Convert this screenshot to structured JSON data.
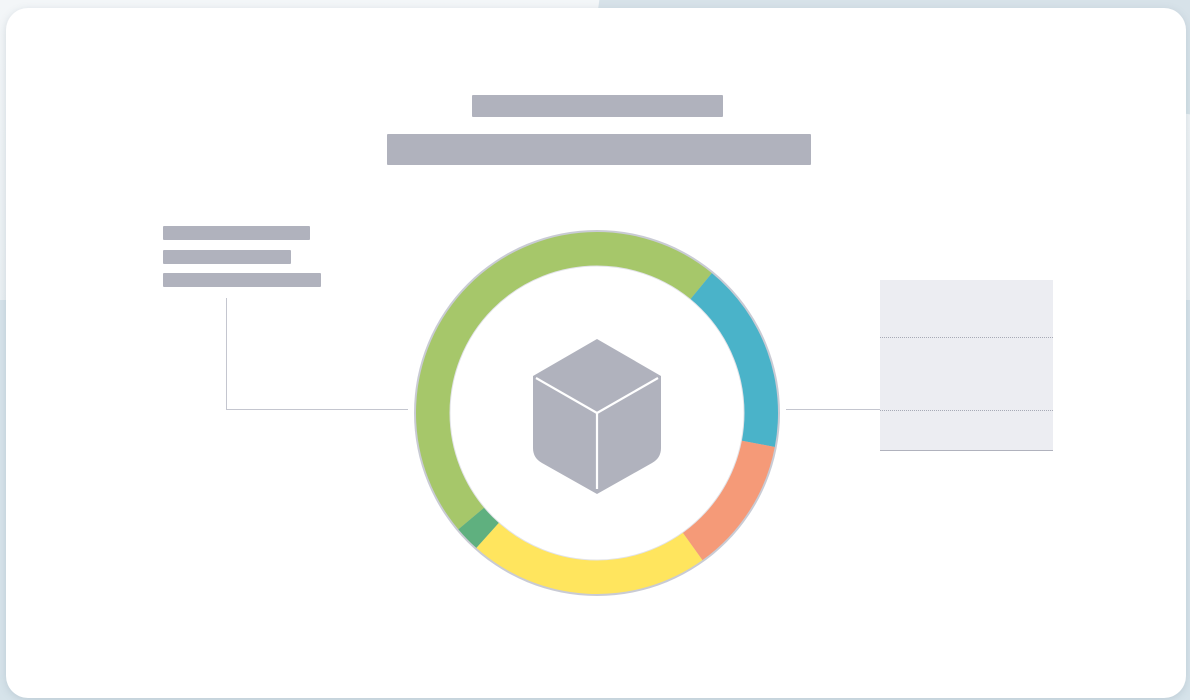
{
  "colors": {
    "accent_green": "#a6c76a",
    "accent_blue": "#4ab3c9",
    "accent_orange": "#f59a78",
    "accent_yellow": "#ffe55e",
    "accent_darkgreen": "#5fb07f",
    "placeholder_gray": "#b0b2bd",
    "panel_bg": "#ecedf2"
  },
  "center_icon": "cube-icon",
  "ring_segments": [
    {
      "name": "green",
      "fraction": 0.455
    },
    {
      "name": "blue",
      "fraction": 0.165
    },
    {
      "name": "orange",
      "fraction": 0.117
    },
    {
      "name": "yellow",
      "fraction": 0.208
    },
    {
      "name": "darkgreen",
      "fraction": 0.022
    }
  ]
}
